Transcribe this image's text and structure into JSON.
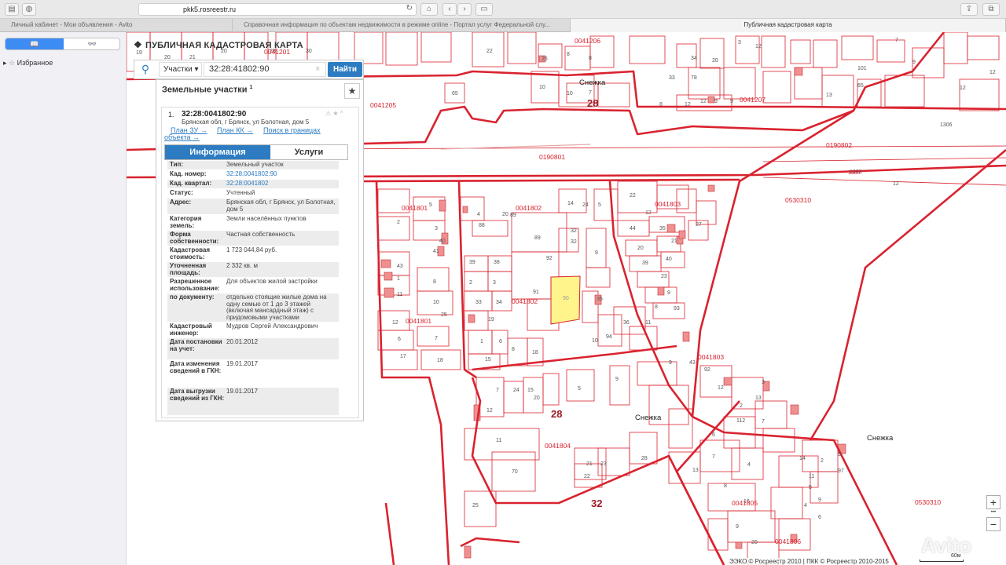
{
  "browser": {
    "url": "pkk5.rosreestr.ru",
    "tabs": [
      "Личный кабинет - Мои объявления - Avito",
      "Справочная информация по объектам недвижимости в режиме online - Портал услуг Федеральной слу...",
      "Публичная кадастровая карта"
    ],
    "sidebar_tab_reader": "📖",
    "sidebar_tab_glasses": "👓",
    "favorites": "Избранное"
  },
  "panel": {
    "title": "ПУБЛИЧНАЯ КАДАСТРОВАЯ КАРТА",
    "search_type": "Участки",
    "search_query": "32:28:41802:90",
    "search_button": "Найти",
    "result_header": "Земельные участки",
    "result_count": "1"
  },
  "card": {
    "number": "1.",
    "cadastral": "32:28:0041802:90",
    "address": "Брянская обл, г Брянск, ул Болотная, дом 5",
    "link_plan_zu": "План ЗУ →",
    "link_plan_kk": "План КК →",
    "link_search": "Поиск в границах",
    "link_search2": "объекта →",
    "tab_info": "Информация",
    "tab_services": "Услуги",
    "rows": [
      {
        "label": "Тип:",
        "value": "Земельный участок"
      },
      {
        "label": "Кад. номер:",
        "value": "32:28:0041802:90"
      },
      {
        "label": "Кад. квартал:",
        "value": "32:28:0041802"
      },
      {
        "label": "Статус:",
        "value": "Учтенный"
      },
      {
        "label": "Адрес:",
        "value": "Брянская обл, г Брянск, ул Болотная, дом 5"
      },
      {
        "label": "Категория земель:",
        "value": "Земли населённых пунктов"
      },
      {
        "label": "Форма собственности:",
        "value": "Частная собственность"
      },
      {
        "label": "Кадастровая стоимость:",
        "value": "1 723 044,84 руб."
      },
      {
        "label": "Уточненная площадь:",
        "value": "2 332 кв. м"
      },
      {
        "label": "Разрешенное использование:",
        "value": "Для объектов жилой застройки"
      },
      {
        "label": "по документу:",
        "value": "отдельно стоящие жилые дома на одну семью от 1 до 3 этажей (включая мансардный этаж) с придомовыми участками"
      },
      {
        "label": "Кадастровый инженер:",
        "value": "Мудров Сергей Александрович"
      },
      {
        "label": "Дата постановки на учет:",
        "value": "20.01.2012"
      },
      {
        "label": "Дата изменения сведений в ГКН:",
        "value": "19.01.2017"
      },
      {
        "label": "Дата выгрузки сведений из ГКН:",
        "value": "19.01.2017"
      }
    ]
  },
  "map": {
    "labels": [
      "0041201",
      "0041205",
      "0041206",
      "0041207",
      "Снежка",
      "28",
      "0190801",
      "0190802",
      "0530310",
      "0041801",
      "0041802",
      "0041803",
      "0041804",
      "0041805",
      "0041806",
      "32",
      "1306",
      "90"
    ],
    "attribution": "ЭЭКО © Росреестр 2010 | ПКК © Росреестр 2010-2015",
    "scale": "60м",
    "watermark": "Avito",
    "zoom_in": "+",
    "zoom_out": "−",
    "zoom_dots": "•••"
  },
  "colors": {
    "boundary": "#d9232f",
    "selected_fill": "#fff48c",
    "building": "#f08f8f",
    "accent": "#2d7cc1"
  }
}
